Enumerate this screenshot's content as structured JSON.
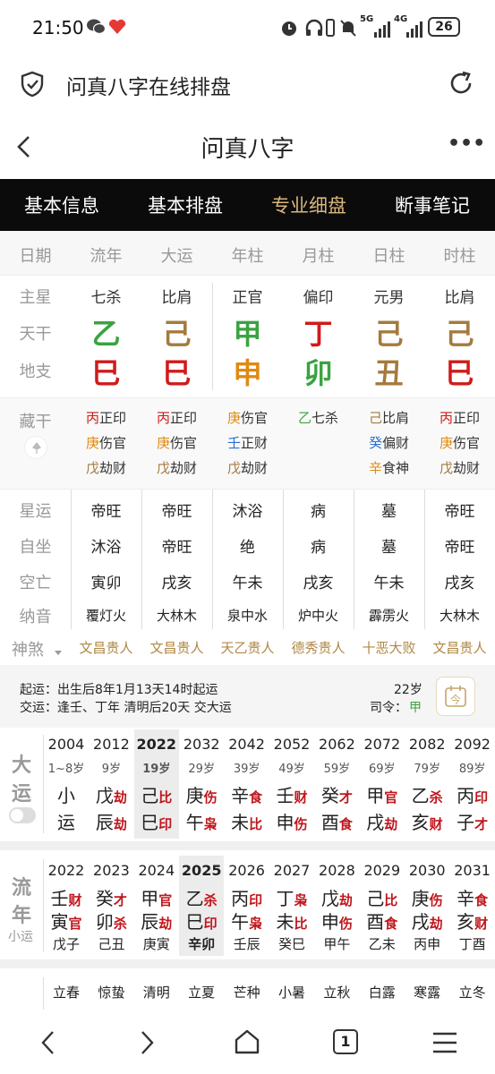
{
  "status": {
    "time": "21:50",
    "battery": "26",
    "net1": "5G",
    "net2": "4G"
  },
  "browser": {
    "title": "问真八字在线排盘"
  },
  "app": {
    "title": "问真八字",
    "more": "•••"
  },
  "tabs": [
    "基本信息",
    "基本排盘",
    "专业细盘",
    "断事笔记"
  ],
  "tab_active": 2,
  "header": [
    "日期",
    "流年",
    "大运",
    "年柱",
    "月柱",
    "日柱",
    "时柱"
  ],
  "row_labels": {
    "zhuxing": "主星",
    "tiangan": "天干",
    "dizhi": "地支",
    "canggan": "藏干",
    "xingyun": "星运",
    "zizuo": "自坐",
    "kongwang": "空亡",
    "nayin": "纳音",
    "shensha": "神煞"
  },
  "zhuxing": [
    "七杀",
    "比肩",
    "正官",
    "偏印",
    "元男",
    "比肩"
  ],
  "tiangan": [
    {
      "c": "乙",
      "k": "g"
    },
    {
      "c": "己",
      "k": "b"
    },
    {
      "c": "甲",
      "k": "g"
    },
    {
      "c": "丁",
      "k": "r"
    },
    {
      "c": "己",
      "k": "b"
    },
    {
      "c": "己",
      "k": "b"
    }
  ],
  "dizhi": [
    {
      "c": "巳",
      "k": "r"
    },
    {
      "c": "巳",
      "k": "r"
    },
    {
      "c": "申",
      "k": "o"
    },
    {
      "c": "卯",
      "k": "g"
    },
    {
      "c": "丑",
      "k": "b"
    },
    {
      "c": "巳",
      "k": "r"
    }
  ],
  "canggan": [
    [
      {
        "s": "丙",
        "k": "r",
        "t": "正印"
      },
      {
        "s": "庚",
        "k": "o",
        "t": "伤官"
      },
      {
        "s": "戊",
        "k": "b",
        "t": "劫财"
      }
    ],
    [
      {
        "s": "丙",
        "k": "r",
        "t": "正印"
      },
      {
        "s": "庚",
        "k": "o",
        "t": "伤官"
      },
      {
        "s": "戊",
        "k": "b",
        "t": "劫财"
      }
    ],
    [
      {
        "s": "庚",
        "k": "o",
        "t": "伤官"
      },
      {
        "s": "壬",
        "k": "bl",
        "t": "正财"
      },
      {
        "s": "戊",
        "k": "b",
        "t": "劫财"
      }
    ],
    [
      {
        "s": "乙",
        "k": "g",
        "t": "七杀"
      }
    ],
    [
      {
        "s": "己",
        "k": "b",
        "t": "比肩"
      },
      {
        "s": "癸",
        "k": "bl",
        "t": "偏财"
      },
      {
        "s": "辛",
        "k": "o",
        "t": "食神"
      }
    ],
    [
      {
        "s": "丙",
        "k": "r",
        "t": "正印"
      },
      {
        "s": "庚",
        "k": "o",
        "t": "伤官"
      },
      {
        "s": "戊",
        "k": "b",
        "t": "劫财"
      }
    ]
  ],
  "xingyun": [
    "帝旺",
    "帝旺",
    "沐浴",
    "病",
    "墓",
    "帝旺"
  ],
  "zizuo": [
    "沐浴",
    "帝旺",
    "绝",
    "病",
    "墓",
    "帝旺"
  ],
  "kongwang": [
    "寅卯",
    "戌亥",
    "午未",
    "戌亥",
    "午未",
    "戌亥"
  ],
  "nayin": [
    "覆灯火",
    "大林木",
    "泉中水",
    "炉中火",
    "霹雳火",
    "大林木"
  ],
  "shensha": [
    "文昌贵人",
    "文昌贵人",
    "天乙贵人",
    "德秀贵人",
    "十恶大败",
    "文昌贵人"
  ],
  "qiyun": {
    "line1": "起运：出生后8年1月13天14时起运",
    "line2": "交运：逢壬、丁年 清明后20天 交大运",
    "age": "22岁",
    "siling_label": "司令：",
    "siling": "甲",
    "btn": "今"
  },
  "dayun": {
    "label1": "大",
    "label2": "运",
    "items": [
      {
        "year": "2004",
        "age": "1~8岁",
        "g": "小",
        "gs": "",
        "z": "运",
        "zs": ""
      },
      {
        "year": "2012",
        "age": "9岁",
        "g": "戊",
        "gs": "劫",
        "z": "辰",
        "zs": "劫"
      },
      {
        "year": "2022",
        "age": "19岁",
        "g": "己",
        "gs": "比",
        "z": "巳",
        "zs": "印"
      },
      {
        "year": "2032",
        "age": "29岁",
        "g": "庚",
        "gs": "伤",
        "z": "午",
        "zs": "枭"
      },
      {
        "year": "2042",
        "age": "39岁",
        "g": "辛",
        "gs": "食",
        "z": "未",
        "zs": "比"
      },
      {
        "year": "2052",
        "age": "49岁",
        "g": "壬",
        "gs": "财",
        "z": "申",
        "zs": "伤"
      },
      {
        "year": "2062",
        "age": "59岁",
        "g": "癸",
        "gs": "才",
        "z": "酉",
        "zs": "食"
      },
      {
        "year": "2072",
        "age": "69岁",
        "g": "甲",
        "gs": "官",
        "z": "戌",
        "zs": "劫"
      },
      {
        "year": "2082",
        "age": "79岁",
        "g": "乙",
        "gs": "杀",
        "z": "亥",
        "zs": "财"
      },
      {
        "year": "2092",
        "age": "89岁",
        "g": "丙",
        "gs": "印",
        "z": "子",
        "zs": "才"
      }
    ]
  },
  "liunian": {
    "label1": "流",
    "label2": "年",
    "sub": "小运",
    "items": [
      {
        "year": "2022",
        "g": "壬",
        "gs": "财",
        "z": "寅",
        "zs": "官",
        "x": "戊子"
      },
      {
        "year": "2023",
        "g": "癸",
        "gs": "才",
        "z": "卯",
        "zs": "杀",
        "x": "己丑"
      },
      {
        "year": "2024",
        "g": "甲",
        "gs": "官",
        "z": "辰",
        "zs": "劫",
        "x": "庚寅"
      },
      {
        "year": "2025",
        "g": "乙",
        "gs": "杀",
        "z": "巳",
        "zs": "印",
        "x": "辛卯"
      },
      {
        "year": "2026",
        "g": "丙",
        "gs": "印",
        "z": "午",
        "zs": "枭",
        "x": "壬辰"
      },
      {
        "year": "2027",
        "g": "丁",
        "gs": "枭",
        "z": "未",
        "zs": "比",
        "x": "癸巳"
      },
      {
        "year": "2028",
        "g": "戊",
        "gs": "劫",
        "z": "申",
        "zs": "伤",
        "x": "甲午"
      },
      {
        "year": "2029",
        "g": "己",
        "gs": "比",
        "z": "酉",
        "zs": "食",
        "x": "乙未"
      },
      {
        "year": "2030",
        "g": "庚",
        "gs": "伤",
        "z": "戌",
        "zs": "劫",
        "x": "丙申"
      },
      {
        "year": "2031",
        "g": "辛",
        "gs": "食",
        "z": "亥",
        "zs": "财",
        "x": "丁酉"
      }
    ]
  },
  "jieqi": [
    "立春",
    "惊蛰",
    "清明",
    "立夏",
    "芒种",
    "小暑",
    "立秋",
    "白露",
    "寒露",
    "立冬"
  ],
  "colors": {
    "green": "#3aa340",
    "brown": "#a47a3e",
    "red": "#d11a1a",
    "orange": "#e08a10",
    "blue": "#2b6fd1",
    "gold": "#d9b77a"
  }
}
